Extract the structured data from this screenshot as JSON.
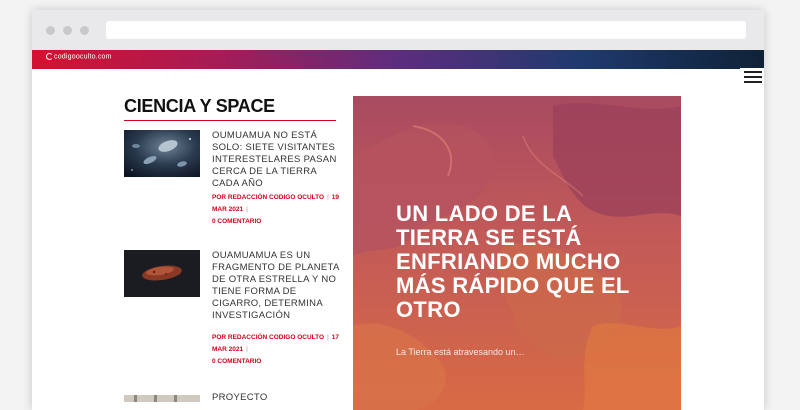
{
  "site": {
    "logo_text": "codigooculto.com"
  },
  "section": {
    "title": "CIENCIA Y SPACE"
  },
  "articles": [
    {
      "title": "OUMUAMUA NO ESTÁ SOLO: SIETE VISITANTES INTERESTELARES PASAN CERCA DE LA TIERRA CADA AÑO",
      "author": "POR REDACCIÓN CODIGO OCULTO",
      "date": "19 MAR 2021",
      "comments": "0 COMENTARIO"
    },
    {
      "title": "OUAMUAMUA ES UN FRAGMENTO DE PLANETA DE OTRA ESTRELLA Y NO TIENE FORMA DE CIGARRO, DETERMINA INVESTIGACIÓN",
      "author": "POR REDACCIÓN CODIGO OCULTO",
      "date": "17 MAR 2021",
      "comments": "0 COMENTARIO"
    },
    {
      "title": "PROYECTO"
    }
  ],
  "hero": {
    "headline": "UN LADO DE LA TIERRA SE ESTÁ ENFRIANDO MUCHO MÁS RÁPIDO QUE EL OTRO",
    "excerpt": "La Tierra está atravesando un…"
  }
}
